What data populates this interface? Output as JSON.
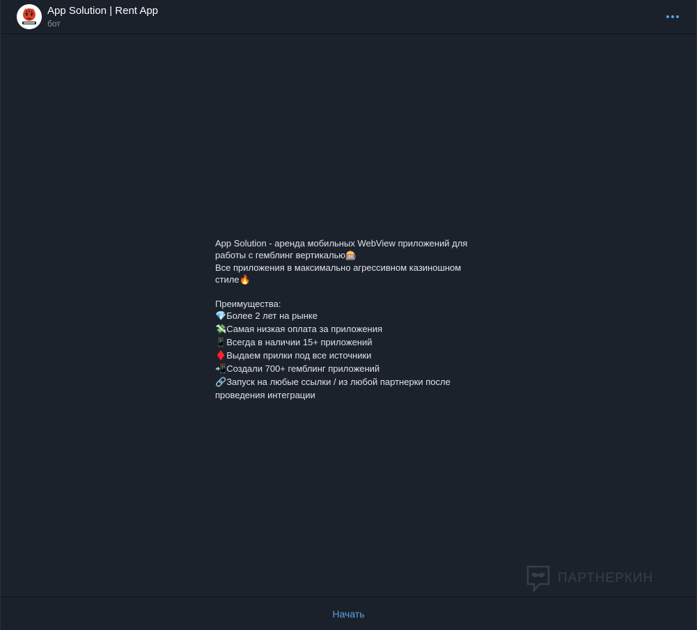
{
  "header": {
    "title": "App Solution | Rent App",
    "subtitle": "бот",
    "avatar_icon": "tiger-logo-icon",
    "more_icon": "more-dots-icon"
  },
  "message": {
    "lines": [
      {
        "text": "App Solution - аренда мобильных WebView приложений для",
        "emoji": ""
      },
      {
        "text": "работы с гемблинг вертикалью",
        "emoji": "🎰",
        "emoji_pos": "end"
      },
      {
        "text": "Все приложения в максимально агрессивном казиношном",
        "emoji": ""
      },
      {
        "text": "стиле",
        "emoji": "🔥",
        "emoji_pos": "end"
      },
      {
        "text": "",
        "emoji": ""
      },
      {
        "text": "Преимущества:",
        "emoji": ""
      },
      {
        "text": "Более 2 лет на рынке",
        "emoji": "💎",
        "emoji_pos": "start"
      },
      {
        "text": "Самая низкая оплата за приложения",
        "emoji": "💸",
        "emoji_pos": "start"
      },
      {
        "text": "Всегда в наличии 15+ приложений",
        "emoji": "📱",
        "emoji_pos": "start"
      },
      {
        "text": "Выдаем прилки под все источники",
        "emoji": "♦️",
        "emoji_pos": "start"
      },
      {
        "text": "Создали 700+ гемблинг приложений",
        "emoji": "📲",
        "emoji_pos": "start"
      },
      {
        "text": "Запуск на любые ссылки / из любой партнерки после",
        "emoji": "🔗",
        "emoji_pos": "start"
      },
      {
        "text": "проведения интеграции",
        "emoji": ""
      }
    ]
  },
  "watermark": {
    "text": "ПАРТНЕРКИН",
    "icon": "mask-icon"
  },
  "bottom": {
    "start_label": "Начать"
  },
  "colors": {
    "background": "#1c222c",
    "header_bg": "#1b212b",
    "accent": "#5aa3e6",
    "text": "#dfe3e8",
    "muted": "#8c96a3"
  }
}
